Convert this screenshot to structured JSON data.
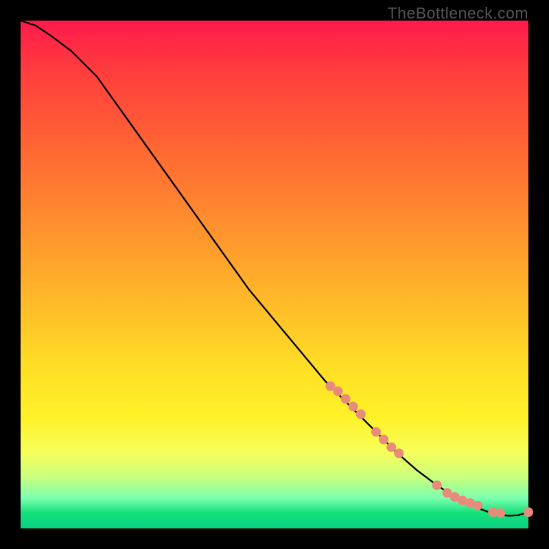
{
  "watermark": "TheBottleneck.com",
  "colors": {
    "curve": "#000000",
    "marker_fill": "#e98b7a",
    "marker_stroke": "#c9644f"
  },
  "chart_data": {
    "type": "line",
    "title": "",
    "xlabel": "",
    "ylabel": "",
    "xlim": [
      0,
      100
    ],
    "ylim": [
      0,
      100
    ],
    "x": [
      0,
      3,
      6,
      10,
      15,
      20,
      25,
      30,
      35,
      40,
      45,
      50,
      55,
      60,
      65,
      70,
      74,
      78,
      82,
      85,
      88,
      90,
      92,
      94,
      96,
      98,
      100
    ],
    "values": [
      100,
      99,
      97,
      94,
      89,
      82,
      75,
      68,
      61,
      54,
      47,
      41,
      35,
      29,
      24,
      19,
      15,
      11.5,
      8.5,
      6.5,
      5,
      4,
      3.3,
      2.8,
      2.5,
      2.6,
      3.2
    ],
    "markers_x": [
      61,
      62.5,
      64,
      65.5,
      67,
      70,
      71.5,
      73,
      74.5,
      82,
      84,
      85.5,
      87,
      88.5,
      90,
      93,
      94.5,
      100
    ],
    "markers_y": [
      28,
      27,
      25.5,
      24,
      22.5,
      19,
      17.5,
      16,
      14.8,
      8.5,
      7,
      6.2,
      5.5,
      5,
      4.5,
      3.2,
      3,
      3.2
    ]
  }
}
